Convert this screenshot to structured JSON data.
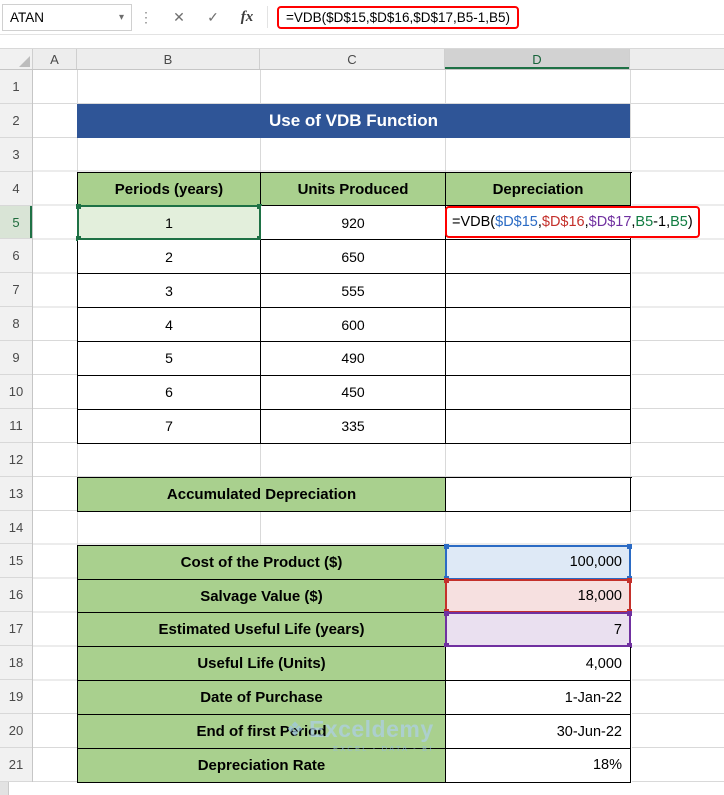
{
  "formula_bar": {
    "name_box_value": "ATAN",
    "formula": "=VDB($D$15,$D$16,$D$17,B5-1,B5)"
  },
  "icons": {
    "chevron_down": "▾",
    "grip_dots": "⋮",
    "cancel": "✕",
    "enter": "✓",
    "insert_function": "fx",
    "watermark_logo": "❖"
  },
  "sheet": {
    "col_headers": [
      "A",
      "B",
      "C",
      "D"
    ],
    "row_numbers": [
      "1",
      "2",
      "3",
      "4",
      "5",
      "6",
      "7",
      "8",
      "9",
      "10",
      "11",
      "12",
      "13",
      "14",
      "15",
      "16",
      "17",
      "18",
      "19",
      "20",
      "21"
    ]
  },
  "banner": {
    "title": "Use of VDB Function"
  },
  "main_table": {
    "headers": [
      "Periods (years)",
      "Units Produced",
      "Depreciation"
    ],
    "rows": [
      {
        "period": "1",
        "units": "920"
      },
      {
        "period": "2",
        "units": "650"
      },
      {
        "period": "3",
        "units": "555"
      },
      {
        "period": "4",
        "units": "600"
      },
      {
        "period": "5",
        "units": "490"
      },
      {
        "period": "6",
        "units": "450"
      },
      {
        "period": "7",
        "units": "335"
      }
    ],
    "cell_formula_segments": [
      {
        "text": "=VDB(",
        "color": "#000000"
      },
      {
        "text": "$D$15",
        "color": "#2b6bc4"
      },
      {
        "text": ",",
        "color": "#000000"
      },
      {
        "text": "$D$16",
        "color": "#c4302b"
      },
      {
        "text": ",",
        "color": "#000000"
      },
      {
        "text": "$D$17",
        "color": "#7030a0"
      },
      {
        "text": ",",
        "color": "#000000"
      },
      {
        "text": "B5",
        "color": "#107c41"
      },
      {
        "text": "-1,",
        "color": "#000000"
      },
      {
        "text": "B5",
        "color": "#107c41"
      },
      {
        "text": ")",
        "color": "#000000"
      }
    ]
  },
  "accumulated_row": {
    "label": "Accumulated Depreciation",
    "value": ""
  },
  "info_table": {
    "rows": [
      {
        "label": "Cost of the Product ($)",
        "value": "100,000",
        "highlight": "blue"
      },
      {
        "label": "Salvage Value ($)",
        "value": "18,000",
        "highlight": "red"
      },
      {
        "label": "Estimated Useful Life (years)",
        "value": "7",
        "highlight": "purple"
      },
      {
        "label": "Useful Life (Units)",
        "value": "4,000",
        "highlight": ""
      },
      {
        "label": "Date of Purchase",
        "value": "1-Jan-22",
        "highlight": ""
      },
      {
        "label": "End of first Period",
        "value": "30-Jun-22",
        "highlight": ""
      },
      {
        "label": "Depreciation Rate",
        "value": "18%",
        "highlight": ""
      }
    ]
  },
  "watermark": {
    "brand": "Exceldemy",
    "tagline": "EXCEL - DATA - BI"
  },
  "colors": {
    "banner_blue": "#2f5597",
    "table_green": "#a9d08e",
    "accent_green": "#1e7145",
    "ref_blue": "#2b6bc4",
    "ref_red": "#c4302b",
    "ref_purple": "#7030a0",
    "ref_green": "#107c41",
    "formula_box_red": "#ff0000"
  }
}
